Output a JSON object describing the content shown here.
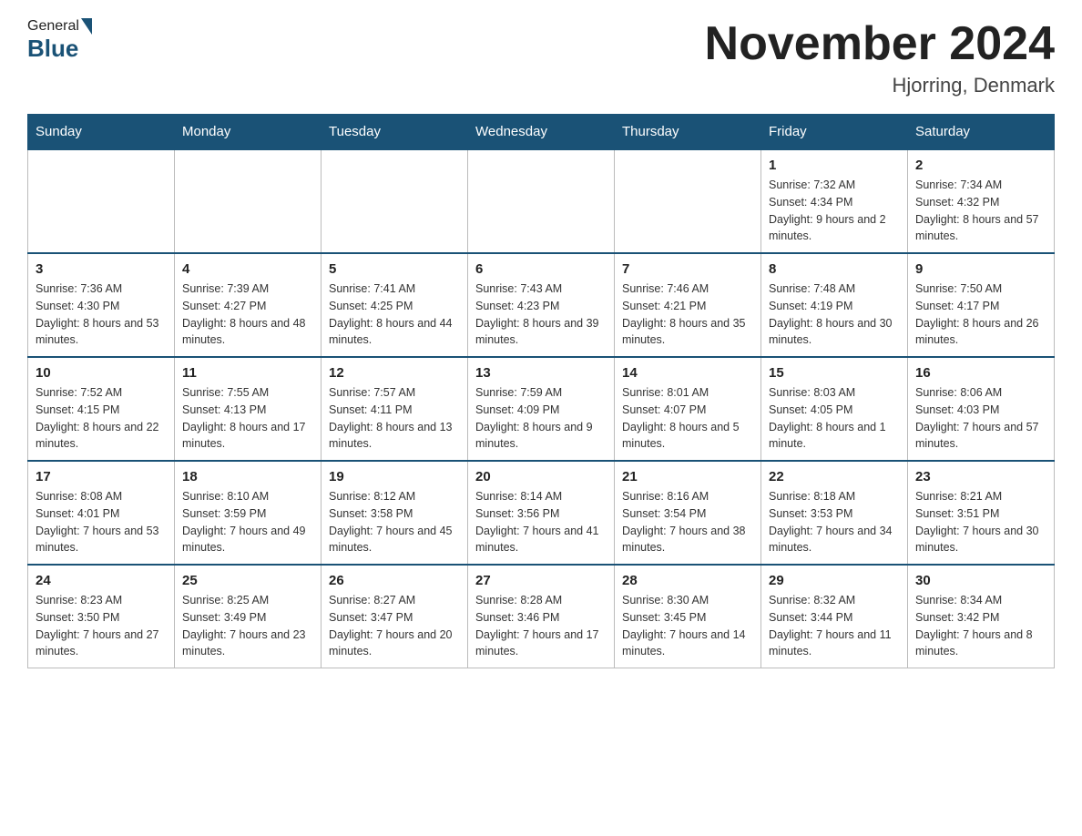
{
  "header": {
    "logo_general": "General",
    "logo_blue": "Blue",
    "month_year": "November 2024",
    "location": "Hjorring, Denmark"
  },
  "days_of_week": [
    "Sunday",
    "Monday",
    "Tuesday",
    "Wednesday",
    "Thursday",
    "Friday",
    "Saturday"
  ],
  "weeks": [
    [
      {
        "day": "",
        "info": ""
      },
      {
        "day": "",
        "info": ""
      },
      {
        "day": "",
        "info": ""
      },
      {
        "day": "",
        "info": ""
      },
      {
        "day": "",
        "info": ""
      },
      {
        "day": "1",
        "info": "Sunrise: 7:32 AM\nSunset: 4:34 PM\nDaylight: 9 hours and 2 minutes."
      },
      {
        "day": "2",
        "info": "Sunrise: 7:34 AM\nSunset: 4:32 PM\nDaylight: 8 hours and 57 minutes."
      }
    ],
    [
      {
        "day": "3",
        "info": "Sunrise: 7:36 AM\nSunset: 4:30 PM\nDaylight: 8 hours and 53 minutes."
      },
      {
        "day": "4",
        "info": "Sunrise: 7:39 AM\nSunset: 4:27 PM\nDaylight: 8 hours and 48 minutes."
      },
      {
        "day": "5",
        "info": "Sunrise: 7:41 AM\nSunset: 4:25 PM\nDaylight: 8 hours and 44 minutes."
      },
      {
        "day": "6",
        "info": "Sunrise: 7:43 AM\nSunset: 4:23 PM\nDaylight: 8 hours and 39 minutes."
      },
      {
        "day": "7",
        "info": "Sunrise: 7:46 AM\nSunset: 4:21 PM\nDaylight: 8 hours and 35 minutes."
      },
      {
        "day": "8",
        "info": "Sunrise: 7:48 AM\nSunset: 4:19 PM\nDaylight: 8 hours and 30 minutes."
      },
      {
        "day": "9",
        "info": "Sunrise: 7:50 AM\nSunset: 4:17 PM\nDaylight: 8 hours and 26 minutes."
      }
    ],
    [
      {
        "day": "10",
        "info": "Sunrise: 7:52 AM\nSunset: 4:15 PM\nDaylight: 8 hours and 22 minutes."
      },
      {
        "day": "11",
        "info": "Sunrise: 7:55 AM\nSunset: 4:13 PM\nDaylight: 8 hours and 17 minutes."
      },
      {
        "day": "12",
        "info": "Sunrise: 7:57 AM\nSunset: 4:11 PM\nDaylight: 8 hours and 13 minutes."
      },
      {
        "day": "13",
        "info": "Sunrise: 7:59 AM\nSunset: 4:09 PM\nDaylight: 8 hours and 9 minutes."
      },
      {
        "day": "14",
        "info": "Sunrise: 8:01 AM\nSunset: 4:07 PM\nDaylight: 8 hours and 5 minutes."
      },
      {
        "day": "15",
        "info": "Sunrise: 8:03 AM\nSunset: 4:05 PM\nDaylight: 8 hours and 1 minute."
      },
      {
        "day": "16",
        "info": "Sunrise: 8:06 AM\nSunset: 4:03 PM\nDaylight: 7 hours and 57 minutes."
      }
    ],
    [
      {
        "day": "17",
        "info": "Sunrise: 8:08 AM\nSunset: 4:01 PM\nDaylight: 7 hours and 53 minutes."
      },
      {
        "day": "18",
        "info": "Sunrise: 8:10 AM\nSunset: 3:59 PM\nDaylight: 7 hours and 49 minutes."
      },
      {
        "day": "19",
        "info": "Sunrise: 8:12 AM\nSunset: 3:58 PM\nDaylight: 7 hours and 45 minutes."
      },
      {
        "day": "20",
        "info": "Sunrise: 8:14 AM\nSunset: 3:56 PM\nDaylight: 7 hours and 41 minutes."
      },
      {
        "day": "21",
        "info": "Sunrise: 8:16 AM\nSunset: 3:54 PM\nDaylight: 7 hours and 38 minutes."
      },
      {
        "day": "22",
        "info": "Sunrise: 8:18 AM\nSunset: 3:53 PM\nDaylight: 7 hours and 34 minutes."
      },
      {
        "day": "23",
        "info": "Sunrise: 8:21 AM\nSunset: 3:51 PM\nDaylight: 7 hours and 30 minutes."
      }
    ],
    [
      {
        "day": "24",
        "info": "Sunrise: 8:23 AM\nSunset: 3:50 PM\nDaylight: 7 hours and 27 minutes."
      },
      {
        "day": "25",
        "info": "Sunrise: 8:25 AM\nSunset: 3:49 PM\nDaylight: 7 hours and 23 minutes."
      },
      {
        "day": "26",
        "info": "Sunrise: 8:27 AM\nSunset: 3:47 PM\nDaylight: 7 hours and 20 minutes."
      },
      {
        "day": "27",
        "info": "Sunrise: 8:28 AM\nSunset: 3:46 PM\nDaylight: 7 hours and 17 minutes."
      },
      {
        "day": "28",
        "info": "Sunrise: 8:30 AM\nSunset: 3:45 PM\nDaylight: 7 hours and 14 minutes."
      },
      {
        "day": "29",
        "info": "Sunrise: 8:32 AM\nSunset: 3:44 PM\nDaylight: 7 hours and 11 minutes."
      },
      {
        "day": "30",
        "info": "Sunrise: 8:34 AM\nSunset: 3:42 PM\nDaylight: 7 hours and 8 minutes."
      }
    ]
  ]
}
